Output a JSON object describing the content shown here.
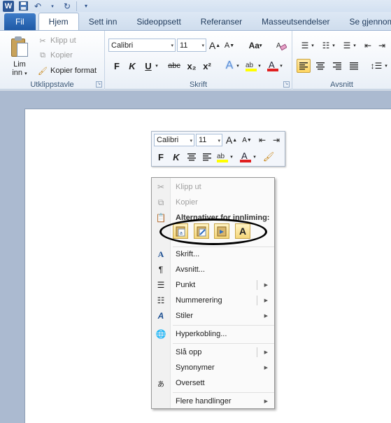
{
  "qat": {
    "logo": "W",
    "save_icon": "save-icon",
    "undo_icon": "undo-icon",
    "redo_icon": "redo-icon"
  },
  "tabs": [
    {
      "label": "Fil"
    },
    {
      "label": "Hjem"
    },
    {
      "label": "Sett inn"
    },
    {
      "label": "Sideoppsett"
    },
    {
      "label": "Referanser"
    },
    {
      "label": "Masseutsendelser"
    },
    {
      "label": "Se gjennom"
    }
  ],
  "ribbon": {
    "clipboard": {
      "paste_label": "Lim",
      "paste_label2": "inn",
      "cut": "Klipp ut",
      "copy": "Kopier",
      "format_painter": "Kopier format",
      "group_label": "Utklippstavle"
    },
    "font": {
      "font_name": "Calibri",
      "font_size": "11",
      "bold": "F",
      "italic": "K",
      "underline": "U",
      "strike": "abc",
      "sub": "x₂",
      "sup": "x²",
      "grow": "A",
      "shrink": "A",
      "case": "Aa",
      "group_label": "Skrift"
    },
    "paragraph": {
      "group_label": "Avsnitt"
    }
  },
  "mini_toolbar": {
    "font_name": "Calibri",
    "font_size": "11",
    "bold": "F",
    "italic": "K"
  },
  "context_menu": {
    "cut": "Klipp ut",
    "copy": "Kopier",
    "paste_header": "Alternativer for innliming:",
    "font": "Skrift...",
    "paragraph": "Avsnitt...",
    "bullets": "Punkt",
    "numbering": "Nummerering",
    "styles": "Stiler",
    "hyperlink": "Hyperkobling...",
    "lookup": "Slå opp",
    "synonyms": "Synonymer",
    "translate": "Oversett",
    "more_actions": "Flere handlinger"
  },
  "colors": {
    "accent": "#2b5797",
    "highlight": "#ffff00",
    "font_color": "#e02020"
  }
}
